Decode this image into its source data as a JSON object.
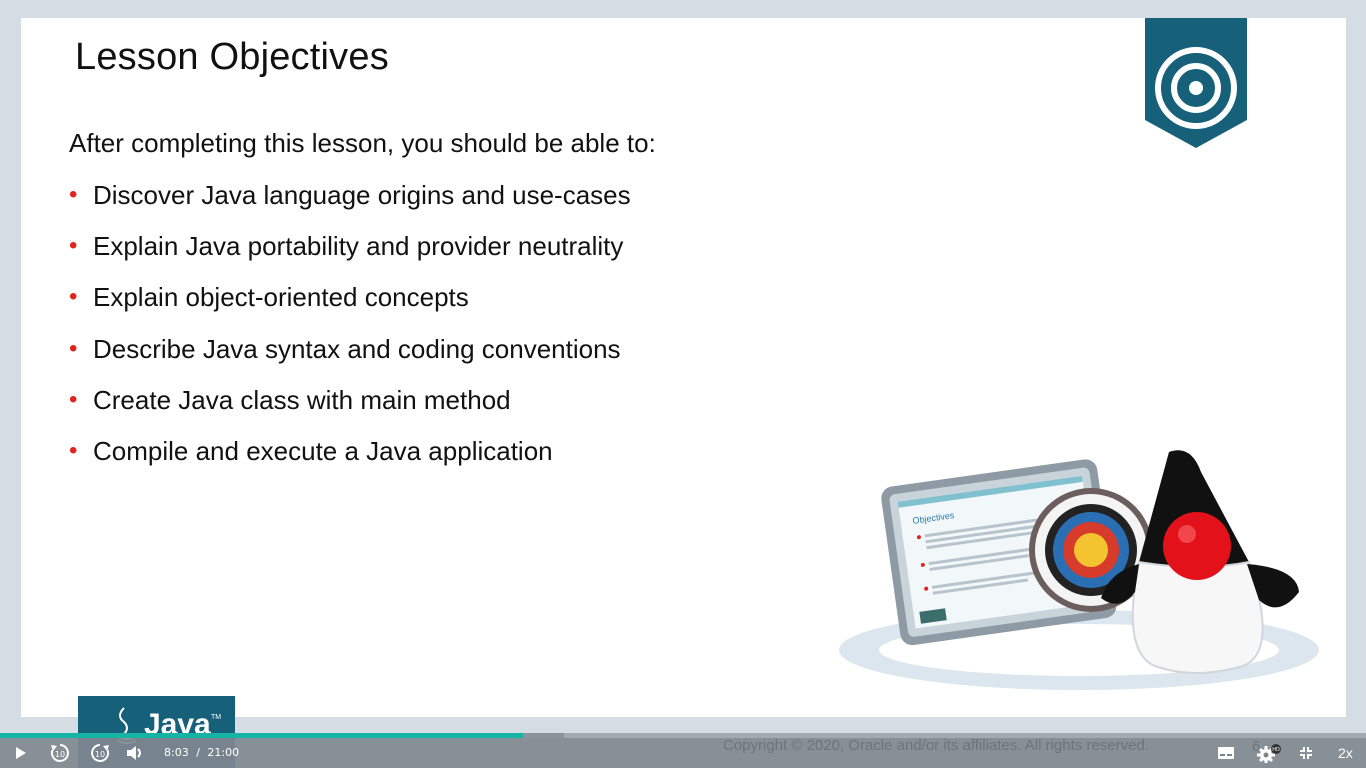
{
  "slide": {
    "title": "Lesson Objectives",
    "intro": "After completing this lesson, you should be able to:",
    "objectives": [
      "Discover Java language origins and use-cases",
      "Explain Java portability and provider neutrality",
      "Explain object-oriented concepts",
      "Describe Java syntax and coding conventions",
      "Create Java class with main method",
      "Compile and execute a Java application"
    ],
    "illustration_board_title": "Objectives",
    "bullet_color": "#e2231a",
    "ribbon_color": "#16607a",
    "copyright": "Copyright © 2020, Oracle and/or its affiliates. All rights reserved.",
    "page_number": "6"
  },
  "logo": {
    "text": "Java",
    "trademark": "TM"
  },
  "player": {
    "current_time": "8:03",
    "separator": "/",
    "duration": "21:00",
    "progress_fraction": 0.383,
    "speed": "2x",
    "hd_badge": "HD",
    "rewind_seconds": "10",
    "forward_seconds": "10",
    "accent_color": "#16b4a4",
    "icons": {
      "play": "play-icon",
      "rewind": "rewind-10-icon",
      "forward": "forward-10-icon",
      "volume": "volume-icon",
      "captions": "captions-icon",
      "settings": "gear-icon",
      "exit_fullscreen": "exit-fullscreen-icon"
    }
  }
}
